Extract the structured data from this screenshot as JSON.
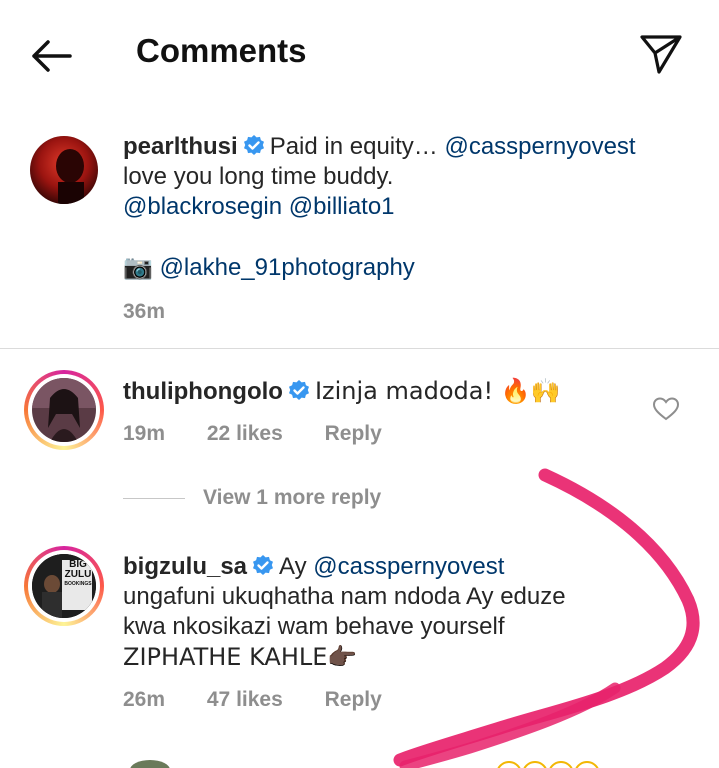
{
  "header": {
    "title": "Comments",
    "back_icon": "arrow-left-icon",
    "send_icon": "paper-plane-icon"
  },
  "caption": {
    "username": "pearlthusi",
    "text_line1": "Paid in equity…",
    "mention1": "@casspernyovest",
    "text_line2": "love you long time buddy.",
    "mention2": "@blackrosegin",
    "mention3": "@billiato1",
    "camera_emoji": "📷",
    "mention4": "@lakhe_91photography",
    "time": "36m"
  },
  "comments": [
    {
      "username": "thuliphongolo",
      "text": "Izinja madoda! 🔥🙌",
      "time": "19m",
      "likes": "22 likes",
      "reply": "Reply",
      "view_replies": "View 1 more reply"
    },
    {
      "username": "bigzulu_sa",
      "text_prefix": "Ay",
      "mention": "@casspernyovest",
      "line2": "ungafuni ukuqhatha nam ndoda Ay eduze",
      "line3": "kwa nkosikazi wam behave yourself",
      "line4": "ZIPHATHE KAHLE👉🏿",
      "time": "26m",
      "likes": "47 likes",
      "reply": "Reply",
      "avatar_text_1": "BIG",
      "avatar_text_2": "ZULU",
      "avatar_text_3": "BOOKINGS"
    }
  ],
  "colors": {
    "verified": "#3897f0",
    "mention": "#00376b",
    "meta": "#8e8e8e",
    "scribble": "#e8226b"
  }
}
